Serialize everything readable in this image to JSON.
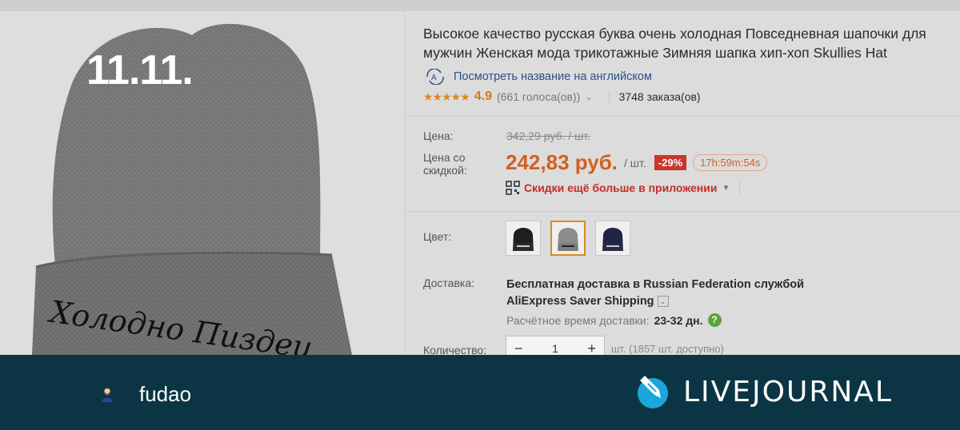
{
  "promo": {
    "label": "11.11."
  },
  "product": {
    "title": "Высокое качество русская буква очень холодная Повседневная шапочки для мужчин Женская мода трикотажные Зимняя шапка хип-хоп Skullies Hat",
    "translate_link": "Посмотреть название на английском",
    "hat_text": "Холодно Пиздец"
  },
  "rating": {
    "stars": "★★★★★",
    "value": "4.9",
    "votes": "(661 голоса(ов))",
    "orders": "3748 заказа(ов)"
  },
  "price": {
    "price_label": "Цена:",
    "old_price": "342,29 руб. / шт.",
    "discount_label_1": "Цена со",
    "discount_label_2": "скидкой:",
    "new_price": "242,83 руб.",
    "per_unit": "/ шт.",
    "discount_badge": "-29%",
    "timer": "17h:59m:54s",
    "app_promo": "Скидки ещё больше в приложении"
  },
  "color": {
    "label": "Цвет:",
    "options": [
      {
        "name": "black",
        "hex": "#1f1f1f",
        "selected": false
      },
      {
        "name": "gray",
        "hex": "#8c8c8c",
        "selected": true
      },
      {
        "name": "navy",
        "hex": "#1f2440",
        "selected": false
      }
    ]
  },
  "shipping": {
    "label": "Доставка:",
    "line1_a": "Бесплатная доставка в ",
    "line1_b": "Russian Federation",
    "line1_c": " службой",
    "line2": "AliExpress Saver Shipping",
    "eta_label": "Расчётное время доставки:",
    "eta_value": "23-32 дн."
  },
  "quantity": {
    "label": "Количество:",
    "minus": "−",
    "value": "1",
    "plus": "+",
    "available": "шт. (1857 шт. доступно)"
  },
  "footer": {
    "username": "fudao",
    "brand": "LIVEJOURNAL",
    "bg_color": "#0b3544"
  }
}
